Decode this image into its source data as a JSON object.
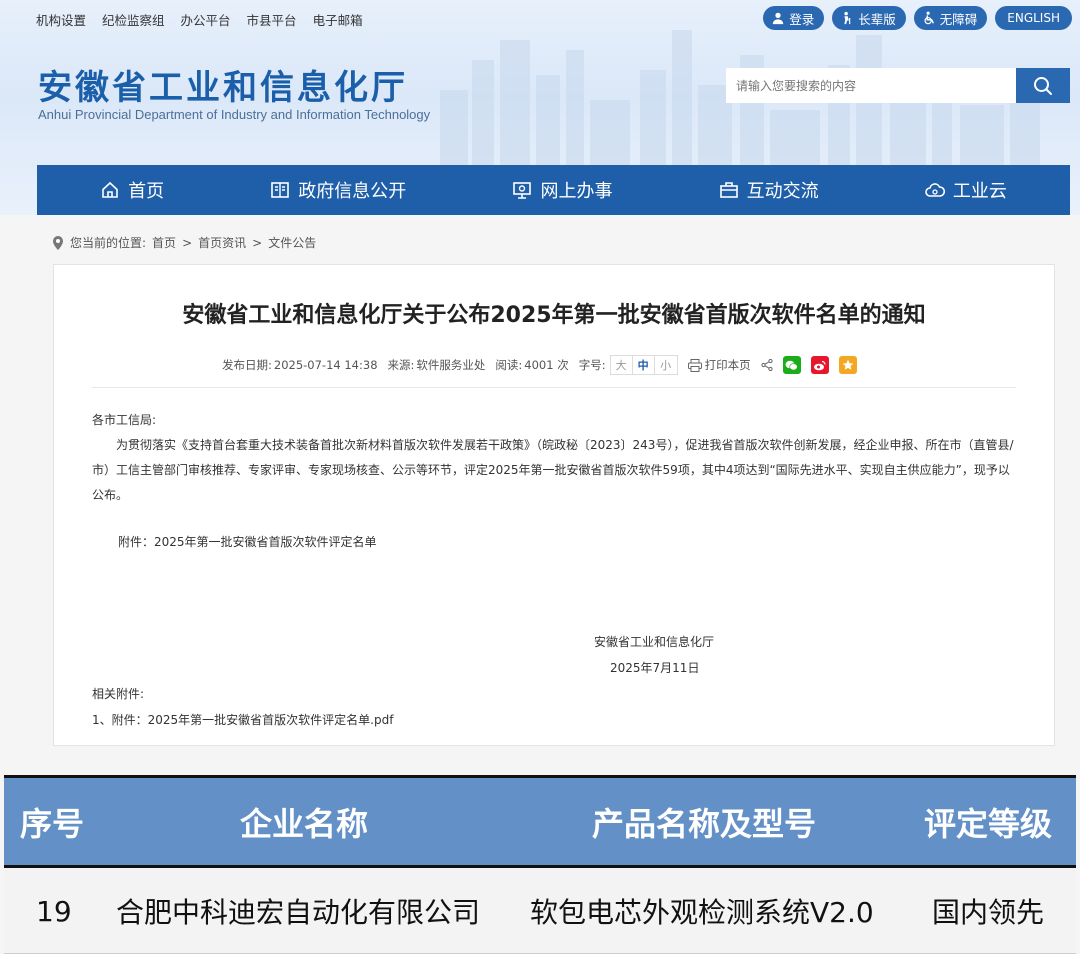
{
  "topbar": {
    "links": [
      "机构设置",
      "纪检监察组",
      "办公平台",
      "市县平台",
      "电子邮箱"
    ],
    "buttons": {
      "login": "登录",
      "elder": "长辈版",
      "accessible": "无障碍",
      "english": "ENGLISH"
    }
  },
  "brand": {
    "name_cn": "安徽省工业和信息化厅",
    "name_en": "Anhui Provincial Department of Industry and Information Technology"
  },
  "search": {
    "placeholder": "请输入您要搜索的内容"
  },
  "nav": {
    "items": [
      {
        "label": "首页",
        "icon": "home-icon"
      },
      {
        "label": "政府信息公开",
        "icon": "book-icon"
      },
      {
        "label": "网上办事",
        "icon": "monitor-icon"
      },
      {
        "label": "互动交流",
        "icon": "briefcase-icon"
      },
      {
        "label": "工业云",
        "icon": "cloud-icon"
      }
    ]
  },
  "breadcrumb": {
    "prefix": "您当前的位置:",
    "items": [
      "首页",
      "首页资讯",
      "文件公告"
    ]
  },
  "article": {
    "title": "安徽省工业和信息化厅关于公布2025年第一批安徽省首版次软件名单的通知",
    "meta": {
      "date_label": "发布日期:",
      "date": "2025-07-14 14:38",
      "source_label": "来源:",
      "source": "软件服务业处",
      "views_label": "阅读:",
      "views": "4001 次",
      "fontsize_label": "字号:",
      "sizes": [
        "大",
        "中",
        "小"
      ],
      "print": "打印本页"
    },
    "greeting": "各市工信局:",
    "paragraph": "为贯彻落实《支持首台套重大技术装备首批次新材料首版次软件发展若干政策》（皖政秘〔2023〕243号），促进我省首版次软件创新发展，经企业申报、所在市（直管县/市）工信主管部门审核推荐、专家评审、专家现场核查、公示等环节，评定2025年第一批安徽省首版次软件59项，其中4项达到“国际先进水平、实现自主供应能力”，现予以公布。",
    "attachment_note": "附件：2025年第一批安徽省首版次软件评定名单",
    "signature_org": "安徽省工业和信息化厅",
    "signature_date": "2025年7月11日",
    "related_label": "相关附件:",
    "related_file": "1、附件：2025年第一批安徽省首版次软件评定名单.pdf"
  },
  "table": {
    "headers": [
      "序号",
      "企业名称",
      "产品名称及型号",
      "评定等级"
    ],
    "rows": [
      [
        "19",
        "合肥中科迪宏自动化有限公司",
        "软包电芯外观检测系统V2.0",
        "国内领先"
      ]
    ]
  },
  "colors": {
    "nav_bg": "#1f5ea8",
    "accent": "#2b68b2",
    "table_header": "#6390c6",
    "wechat": "#1aad19",
    "weibo": "#e6162d",
    "qzone": "#f5a623"
  }
}
